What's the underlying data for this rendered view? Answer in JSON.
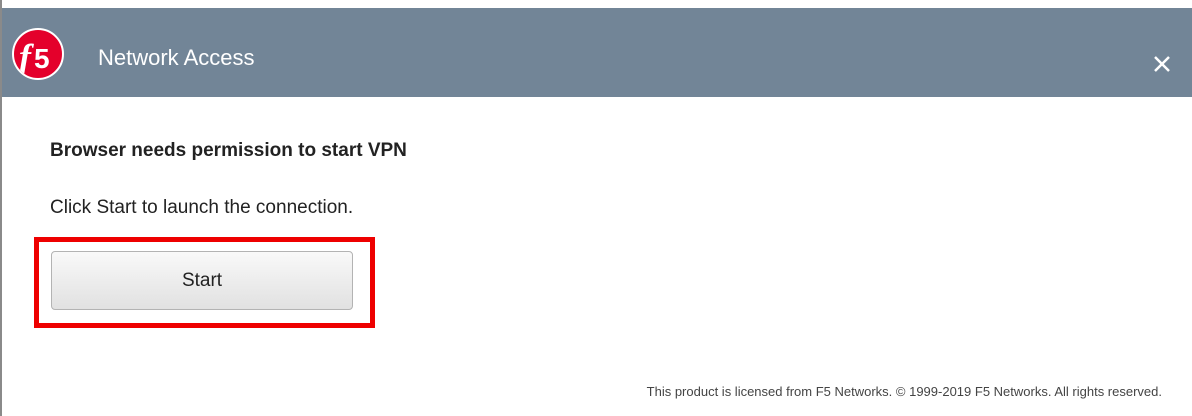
{
  "window": {
    "title": "Network Access",
    "logo_text": "f5"
  },
  "content": {
    "heading": "Browser needs permission to start VPN",
    "instruction": "Click Start to launch the connection.",
    "start_label": "Start"
  },
  "footer": {
    "license": "This product is licensed from F5 Networks. © 1999-2019 F5 Networks. All rights reserved."
  },
  "colors": {
    "titlebar": "#728597",
    "logo": "#e4002b",
    "highlight": "#ee0000"
  },
  "icons": {
    "close": "close-icon",
    "logo": "f5-logo-icon"
  }
}
